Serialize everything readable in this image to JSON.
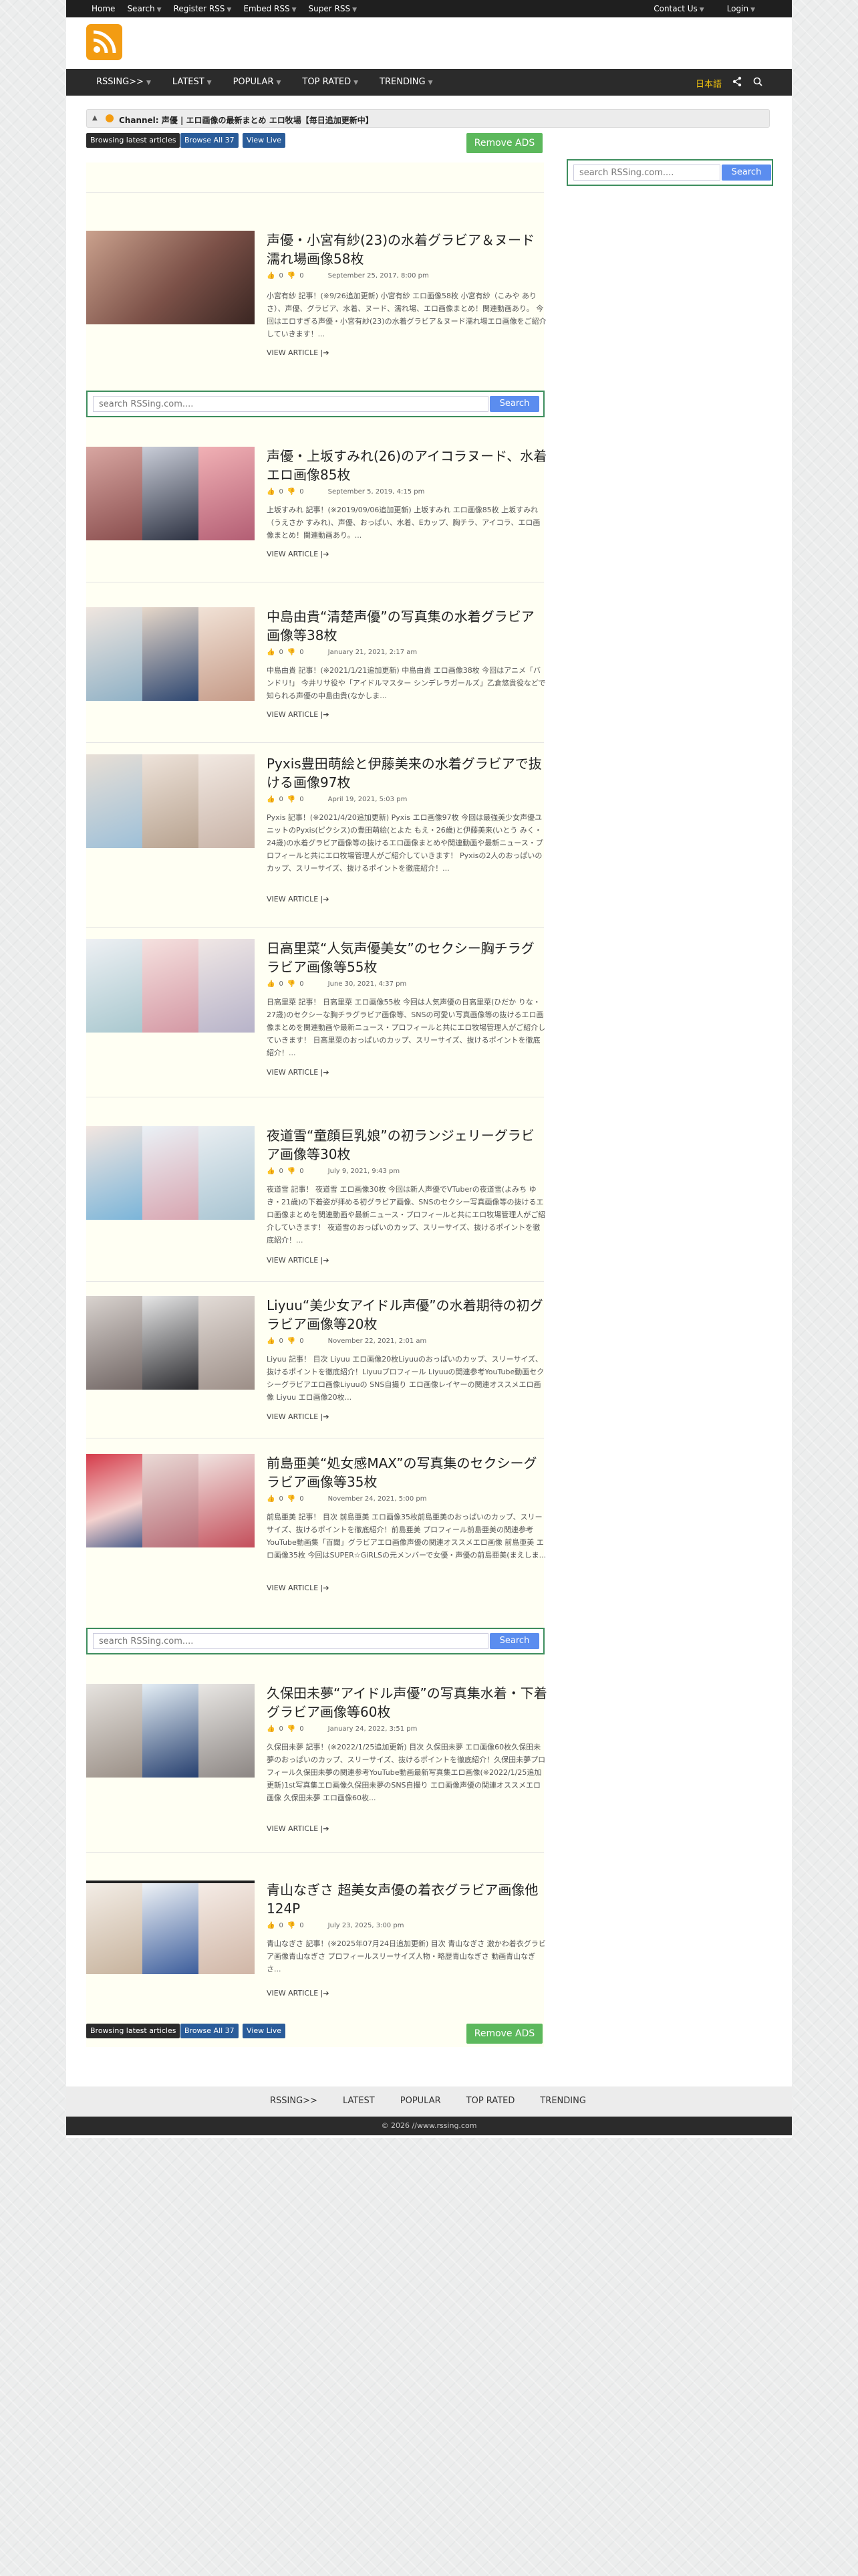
{
  "topbar": {
    "left": [
      "Home",
      "Search",
      "Register RSS",
      "Embed RSS",
      "Super RSS"
    ],
    "right": [
      "Contact Us",
      "Login"
    ]
  },
  "nav": {
    "items": [
      "RSSING>>",
      "LATEST",
      "POPULAR",
      "TOP RATED",
      "TRENDING"
    ],
    "lang": "日本語"
  },
  "channel": {
    "label": "Channel:",
    "title": "声優 | エロ画像の最新まとめ エロ牧場【毎日追加更新中】"
  },
  "buttons": {
    "browse_latest": "Browsing latest articles",
    "browse_all": "Browse All 37",
    "view_live": "View Live",
    "remove_ads": "Remove ADS"
  },
  "search": {
    "placeholder": "search RSSing.com....",
    "button": "Search"
  },
  "articles": [
    {
      "title": "声優・小宮有紗(23)の水着グラビア＆ヌード濡れ場画像58枚",
      "date": "September 25, 2017, 8:00 pm",
      "likes": "0",
      "dislikes": "0",
      "excerpt": "小宮有紗 記事！(※9/26追加更新) 小宮有紗 エロ画像58枚 小宮有紗（こみや ありさ）、声優、グラビア、水着、ヌード、濡れ場、エロ画像まとめ！関連動画あり。 今回はエロすぎる声優・小宮有紗(23)の水着グラビア＆ヌード濡れ場エロ画像をご紹介していきます！...",
      "readmore": "VIEW ARTICLE"
    },
    {
      "title": "声優・上坂すみれ(26)のアイコラヌード、水着エロ画像85枚",
      "date": "September 5, 2019, 4:15 pm",
      "likes": "0",
      "dislikes": "0",
      "excerpt": "上坂すみれ 記事！(※2019/09/06追加更新) 上坂すみれ エロ画像85枚 上坂すみれ（うえさか すみれ)、声優、おっぱい、水着、Eカップ、胸チラ、アイコラ、エロ画像まとめ！関連動画あり。...",
      "readmore": "VIEW ARTICLE"
    },
    {
      "title": "中島由貴“清楚声優”の写真集の水着グラビア画像等38枚",
      "date": "January 21, 2021, 2:17 am",
      "likes": "0",
      "dislikes": "0",
      "excerpt": "中島由貴 記事！(※2021/1/21追加更新) 中島由貴 エロ画像38枚 今回はアニメ「バンドリ!」 今井リサ役や「アイドルマスター シンデレラガールズ」乙倉悠貴役などで知られる声優の中島由貴(なかしま...",
      "readmore": "VIEW ARTICLE"
    },
    {
      "title": "Pyxis豊田萌絵と伊藤美来の水着グラビアで抜ける画像97枚",
      "date": "April 19, 2021, 5:03 pm",
      "likes": "0",
      "dislikes": "0",
      "excerpt": "Pyxis 記事！(※2021/4/20追加更新) Pyxis エロ画像97枚 今回は最強美少女声優ユニットのPyxis(ピクシス)の豊田萌絵(とよた もえ・26歳)と伊藤美来(いとう みく・24歳)の水着グラビア画像等の抜けるエロ画像まとめや関連動画や最新ニュース・プロフィールと共にエロ牧場管理人がご紹介していきます！ Pyxisの2人のおっぱいのカップ、スリーサイズ、抜けるポイントを徹底紹介！...",
      "readmore": "VIEW ARTICLE"
    },
    {
      "title": "日高里菜“人気声優美女”のセクシー胸チラグラビア画像等55枚",
      "date": "June 30, 2021, 4:37 pm",
      "likes": "0",
      "dislikes": "0",
      "excerpt": "日高里菜 記事！ 日高里菜 エロ画像55枚 今回は人気声優の日高里菜(ひだか りな・27歳)のセクシーな胸チラグラビア画像等、SNSの可愛い写真画像等の抜けるエロ画像まとめを関連動画や最新ニュース・プロフィールと共にエロ牧場管理人がご紹介していきます！ 日高里菜のおっぱいのカップ、スリーサイズ、抜けるポイントを徹底紹介！...",
      "readmore": "VIEW ARTICLE"
    },
    {
      "title": "夜道雪“童顔巨乳娘”の初ランジェリーグラビア画像等30枚",
      "date": "July 9, 2021, 9:43 pm",
      "likes": "0",
      "dislikes": "0",
      "excerpt": "夜道雪 記事！ 夜道雪 エロ画像30枚 今回は新人声優でVTuberの夜道雪(よみち ゆき・21歳)の下着姿が拝める初グラビア画像、SNSのセクシー写真画像等の抜けるエロ画像まとめを関連動画や最新ニュース・プロフィールと共にエロ牧場管理人がご紹介していきます！ 夜道雪のおっぱいのカップ、スリーサイズ、抜けるポイントを徹底紹介！...",
      "readmore": "VIEW ARTICLE"
    },
    {
      "title": "Liyuu“美少女アイドル声優”の水着期待の初グラビア画像等20枚",
      "date": "November 22, 2021, 2:01 am",
      "likes": "0",
      "dislikes": "0",
      "excerpt": "Liyuu 記事！ 目次 Liyuu エロ画像20枚Liyuuのおっぱいのカップ、スリーサイズ、抜けるポイントを徹底紹介！Liyuuプロフィール Liyuuの関連参考YouTube動画セクシーグラビアエロ画像Liyuuの SNS自撮り エロ画像レイヤーの関連オススメエロ画像 Liyuu エロ画像20枚...",
      "readmore": "VIEW ARTICLE"
    },
    {
      "title": "前島亜美“処女感MAX”の写真集のセクシーグラビア画像等35枚",
      "date": "November 24, 2021, 5:00 pm",
      "likes": "0",
      "dislikes": "0",
      "excerpt": "前島亜美 記事！ 目次 前島亜美 エロ画像35枚前島亜美のおっぱいのカップ、スリーサイズ、抜けるポイントを徹底紹介！前島亜美 プロフィール前島亜美の関連参考YouTube動画集「百聞」グラビアエロ画像声優の関連オススメエロ画像 前島亜美 エロ画像35枚 今回はSUPER☆GiRLSの元メンバーで女優・声優の前島亜美(まえしま...",
      "readmore": "VIEW ARTICLE"
    },
    {
      "title": "久保田未夢“アイドル声優”の写真集水着・下着グラビア画像等60枚",
      "date": "January 24, 2022, 3:51 pm",
      "likes": "0",
      "dislikes": "0",
      "excerpt": "久保田未夢 記事！(※2022/1/25追加更新) 目次 久保田未夢 エロ画像60枚久保田未夢のおっぱいのカップ、スリーサイズ、抜けるポイントを徹底紹介！久保田未夢プロフィール久保田未夢の関連参考YouTube動画最新写真集エロ画像(※2022/1/25追加更新)1st写真集エロ画像久保田未夢のSNS自撮り エロ画像声優の関連オススメエロ画像 久保田未夢 エロ画像60枚...",
      "readmore": "VIEW ARTICLE"
    },
    {
      "title": "青山なぎさ 超美女声優の着衣グラビア画像他124P",
      "date": "July 23, 2025, 3:00 pm",
      "likes": "0",
      "dislikes": "0",
      "excerpt": "青山なぎさ 記事！(※2025年07月24日追加更新) 目次 青山なぎさ 激かわ着衣グラビア画像青山なぎさ プロフィールスリーサイズ人物・略歴青山なぎさ 動画青山なぎさ...",
      "readmore": "VIEW ARTICLE"
    }
  ],
  "footer": {
    "items": [
      "RSSING>>",
      "LATEST",
      "POPULAR",
      "TOP RATED",
      "TRENDING"
    ],
    "copyright": "© 2026 //www.rssing.com"
  },
  "colors": {
    "accent_orange": "#f39c12",
    "button_green": "#5cb85c",
    "search_blue": "#5b8def",
    "dark_bar": "#1f1f1f"
  }
}
